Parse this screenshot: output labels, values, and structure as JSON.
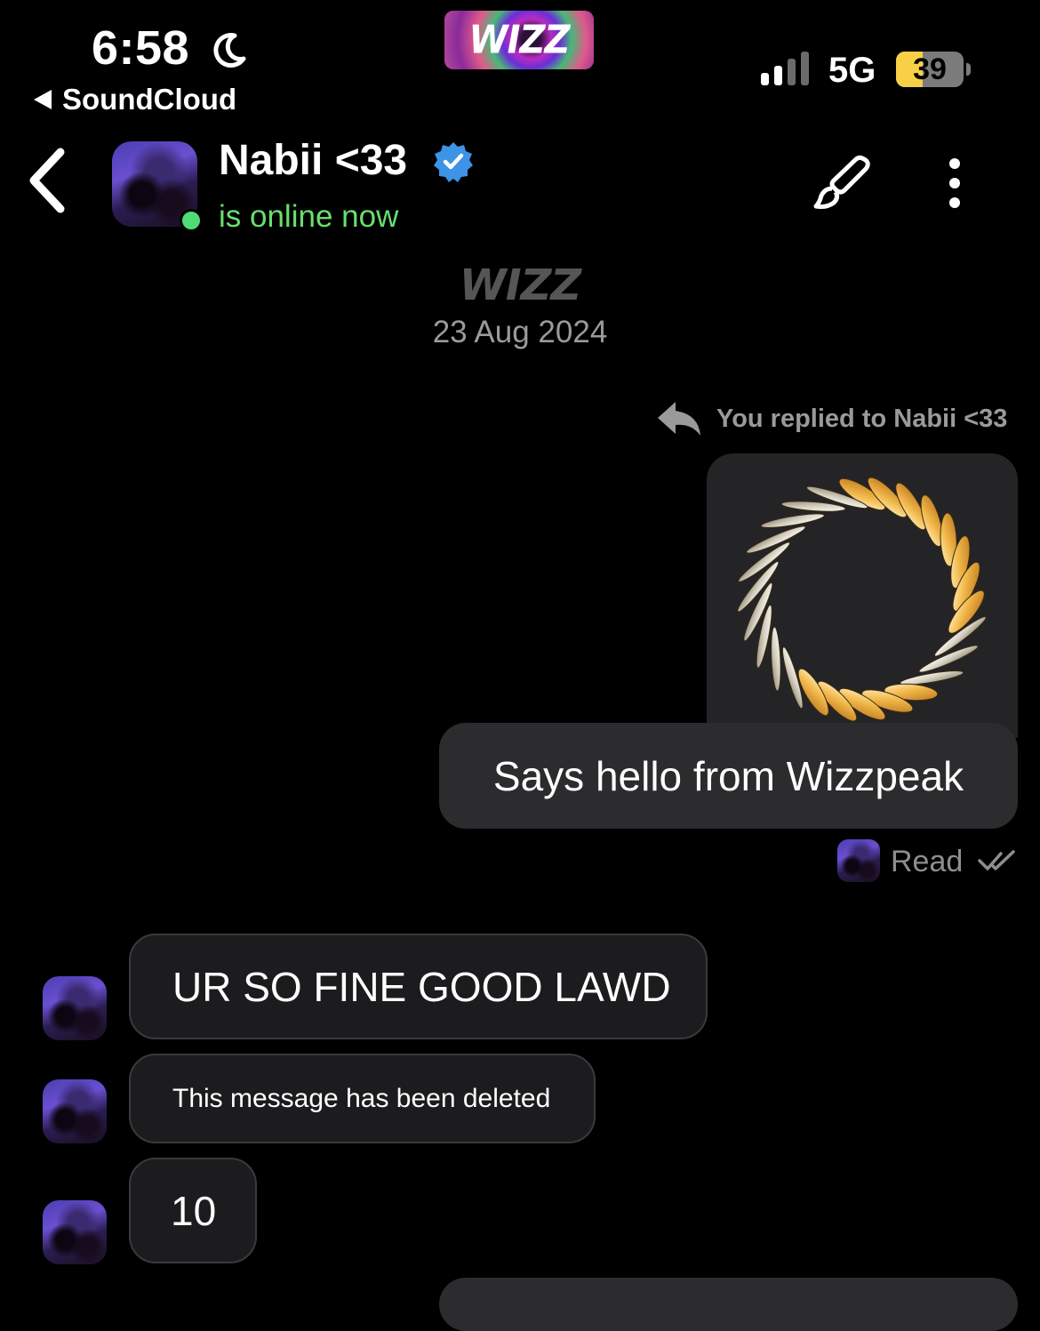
{
  "status_bar": {
    "time": "6:58",
    "back_app": "SoundCloud",
    "app_badge": "WIZZ",
    "network": "5G",
    "battery_level": 39,
    "battery_label": "39",
    "icons": [
      "moon-icon",
      "signal-icon",
      "battery-icon"
    ]
  },
  "header": {
    "contact_name": "Nabii <33",
    "presence": "is online now",
    "icons": [
      "back-chevron-icon",
      "verified-badge-icon",
      "brush-icon",
      "more-vertical-icon"
    ],
    "colors": {
      "presence": "#67df6d",
      "verified": "#3d93e6"
    }
  },
  "conversation": {
    "brand_mark": "WIZZ",
    "date": "23 Aug 2024",
    "reply_indicator": "You replied to Nabii <33",
    "outgoing": {
      "text": "Says hello from Wizzpeak",
      "receipt": "Read"
    },
    "incoming": [
      {
        "text": "UR SO FINE GOOD LAWD"
      },
      {
        "text": "This message has been deleted"
      },
      {
        "text": "10"
      }
    ]
  }
}
